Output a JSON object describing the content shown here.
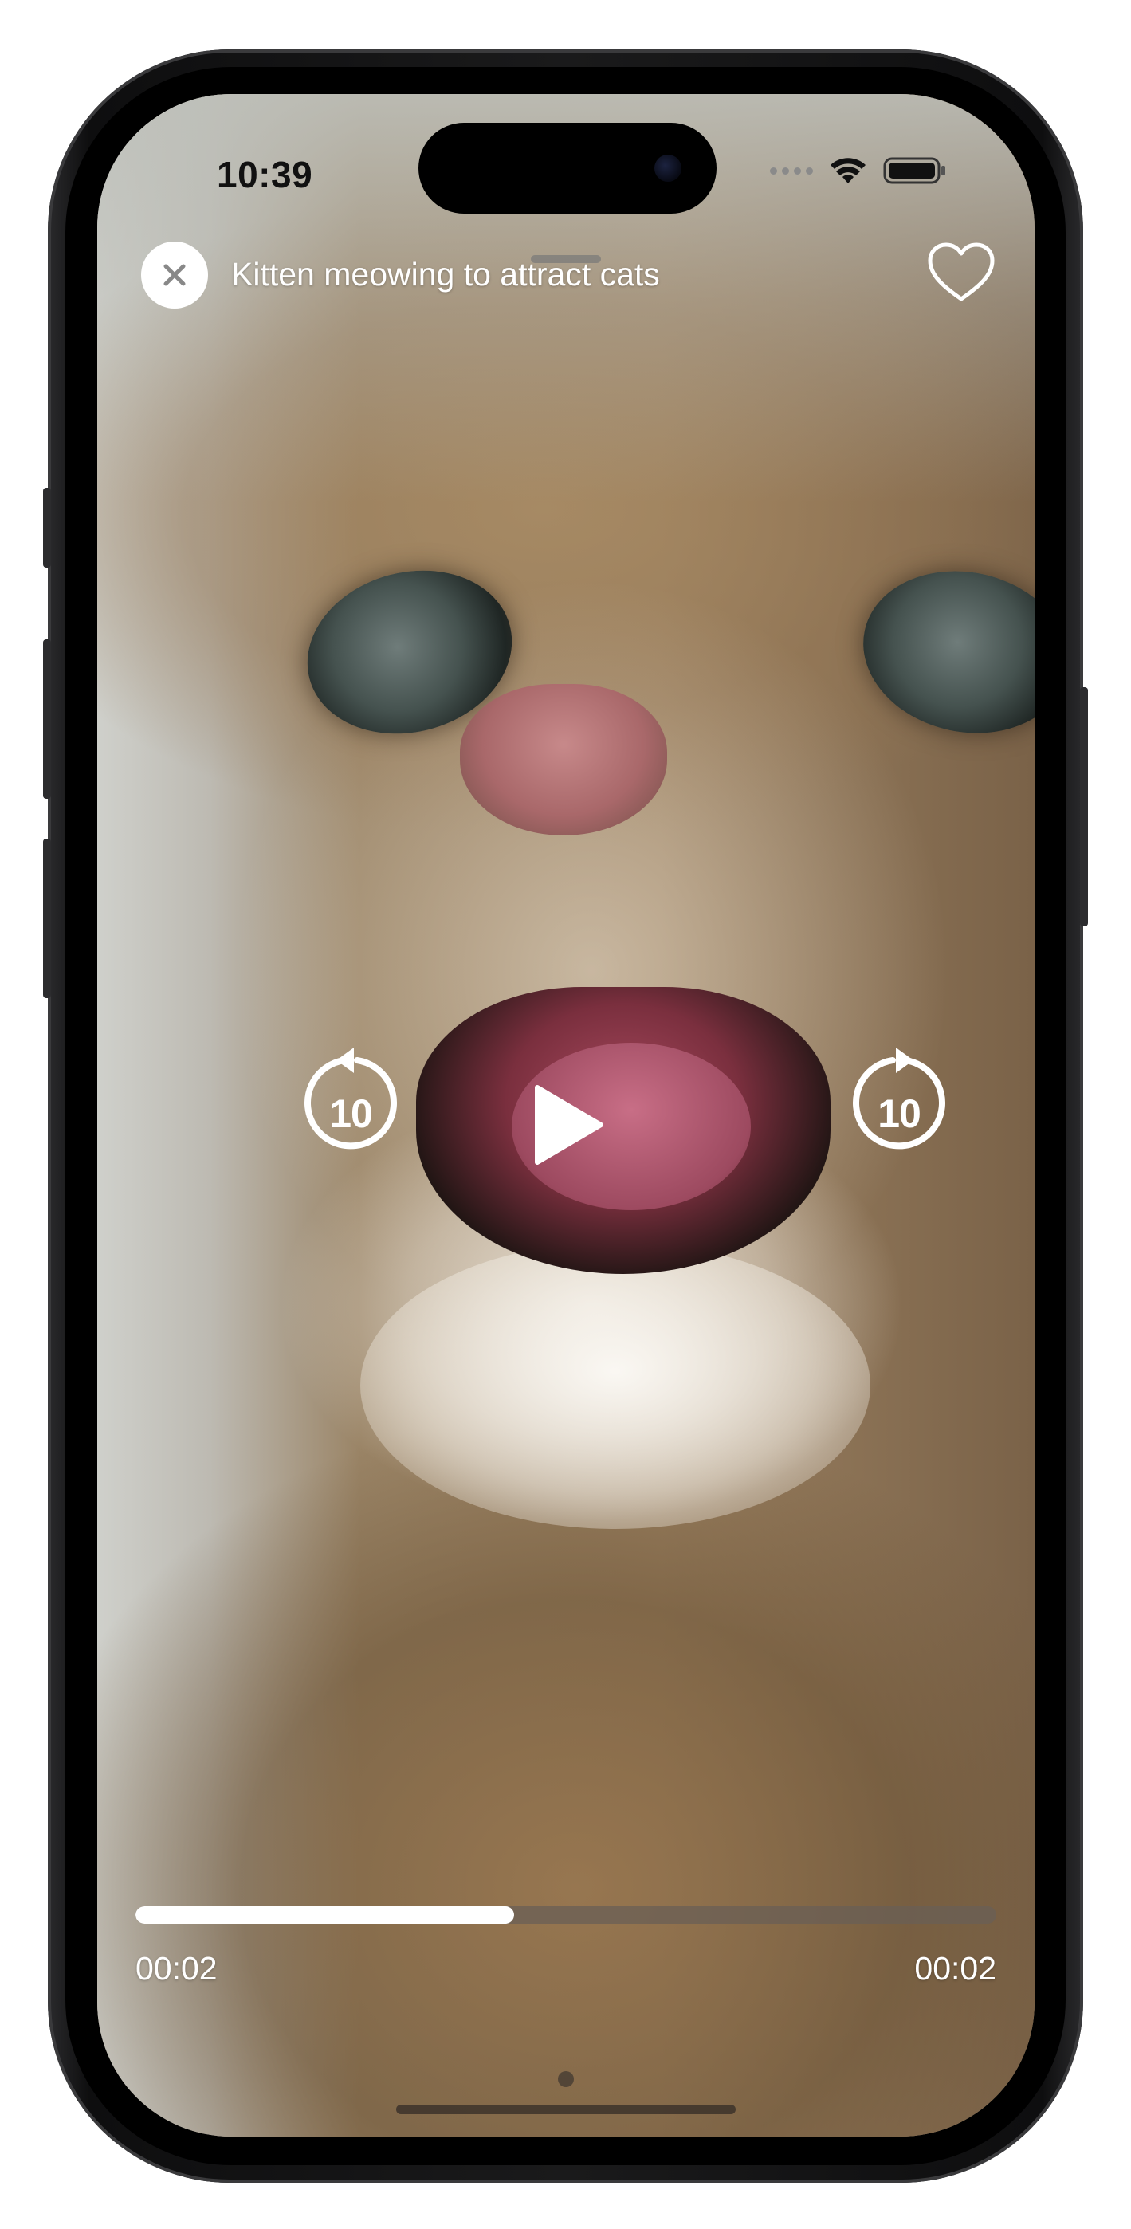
{
  "status_bar": {
    "time": "10:39",
    "icons": [
      "cellular-icon",
      "wifi-icon",
      "battery-icon"
    ]
  },
  "player": {
    "title": "Kitten meowing to attract cats",
    "close_icon": "close-icon",
    "favorite_icon": "heart-outline-icon",
    "controls": {
      "skip_back_label": "10",
      "skip_forward_label": "10",
      "play_icon": "play-icon"
    },
    "progress": {
      "fraction": 0.44,
      "elapsed": "00:02",
      "remaining": "00:02"
    }
  },
  "colors": {
    "overlay_text": "#ffffff",
    "progress_fill": "#ffffff",
    "progress_track": "#695f55"
  }
}
